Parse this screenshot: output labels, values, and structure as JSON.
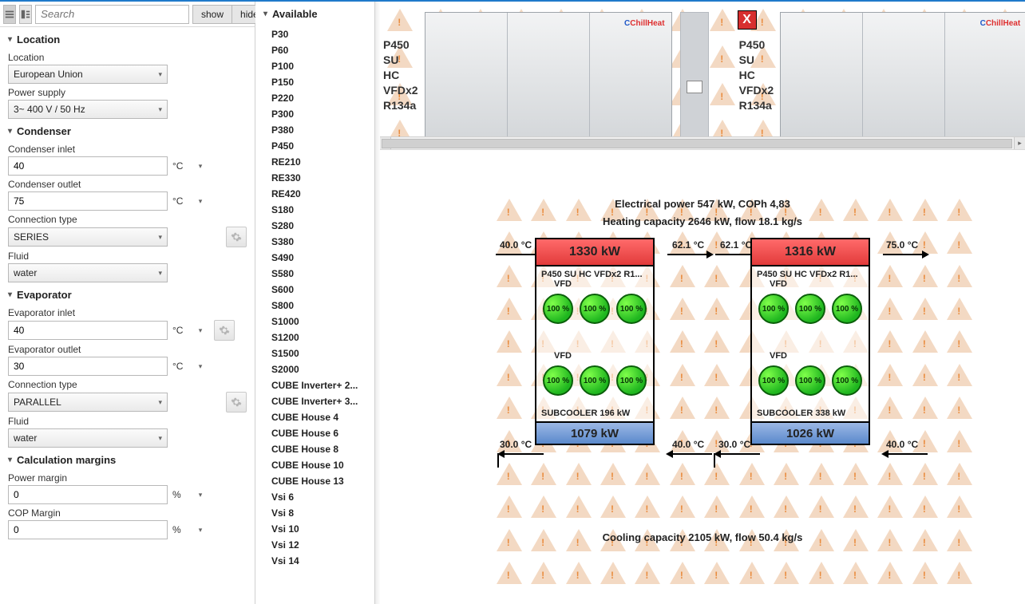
{
  "toolbar": {
    "search_placeholder": "Search",
    "show": "show",
    "hide": "hide"
  },
  "sections": {
    "location": {
      "title": "Location",
      "location_label": "Location",
      "location_value": "European Union",
      "power_label": "Power supply",
      "power_value": "3~ 400 V / 50 Hz"
    },
    "condenser": {
      "title": "Condenser",
      "inlet_label": "Condenser inlet",
      "inlet_value": "40",
      "outlet_label": "Condenser outlet",
      "outlet_value": "75",
      "conn_label": "Connection type",
      "conn_value": "SERIES",
      "fluid_label": "Fluid",
      "fluid_value": "water",
      "unit": "°C"
    },
    "evaporator": {
      "title": "Evaporator",
      "inlet_label": "Evaporator inlet",
      "inlet_value": "40",
      "outlet_label": "Evaporator outlet",
      "outlet_value": "30",
      "conn_label": "Connection type",
      "conn_value": "PARALLEL",
      "fluid_label": "Fluid",
      "fluid_value": "water",
      "unit": "°C"
    },
    "margins": {
      "title": "Calculation margins",
      "power_label": "Power margin",
      "power_value": "0",
      "cop_label": "COP Margin",
      "cop_value": "0",
      "unit": "%"
    }
  },
  "available": {
    "title": "Available",
    "items": [
      "P30",
      "P60",
      "P100",
      "P150",
      "P220",
      "P300",
      "P380",
      "P450",
      "RE210",
      "RE330",
      "RE420",
      "S180",
      "S280",
      "S380",
      "S490",
      "S580",
      "S600",
      "S800",
      "S1000",
      "S1200",
      "S1500",
      "S2000",
      "CUBE Inverter+ 2...",
      "CUBE Inverter+ 3...",
      "CUBE House 4",
      "CUBE House 6",
      "CUBE House 8",
      "CUBE House 10",
      "CUBE House 13",
      "Vsi 6",
      "Vsi 8",
      "Vsi 10",
      "Vsi 12",
      "Vsi 14"
    ]
  },
  "product_labels": [
    "P450",
    "SU",
    "HC",
    "VFDx2",
    "R134a"
  ],
  "brand": "ChillHeat",
  "close_x": "X",
  "summary": {
    "line1": "Electrical power 547 kW, COPh 4,83",
    "line2": "Heating capacity 2646 kW, flow 18.1 kg/s",
    "cooling": "Cooling capacity 2105 kW, flow 50.4 kg/s"
  },
  "temps": {
    "t_in": "40.0 °C",
    "t_mid": "62.1 °C",
    "t_out": "75.0 °C",
    "c_in": "30.0 °C",
    "c_out": "40.0 °C"
  },
  "unit1": {
    "heat": "1330 kW",
    "model": "P450 SU HC VFDx2 R1...",
    "vfd": "VFD",
    "pct": "100 %",
    "sub": "SUBCOOLER 196 kW",
    "cool": "1079 kW"
  },
  "unit2": {
    "heat": "1316 kW",
    "model": "P450 SU HC VFDx2 R1...",
    "vfd": "VFD",
    "pct": "100 %",
    "sub": "SUBCOOLER 338 kW",
    "cool": "1026 kW"
  }
}
